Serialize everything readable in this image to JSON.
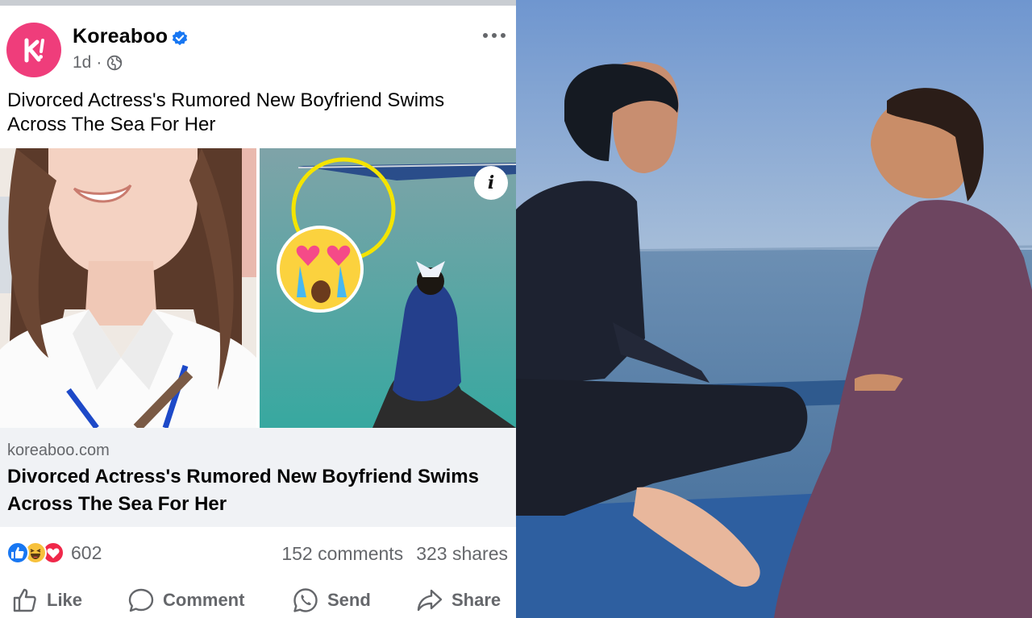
{
  "post": {
    "page_name": "Koreaboo",
    "time": "1d",
    "caption": "Divorced Actress's Rumored New Boyfriend Swims Across The Sea For Her",
    "info_label": "i",
    "link": {
      "domain": "koreaboo.com",
      "title": "Divorced Actress's Rumored New Boyfriend Swims Across The Sea For Her"
    },
    "reaction_count": "602",
    "comments": "152 comments",
    "shares": "323 shares",
    "actions": {
      "like": "Like",
      "comment": "Comment",
      "send": "Send",
      "share": "Share"
    }
  },
  "colors": {
    "brand_pink": "#ef3d7b",
    "verified_blue": "#1877f2",
    "muted_text": "#65676b",
    "link_bg": "#f0f2f5"
  },
  "icons": [
    "koreaboo-logo",
    "verified-icon",
    "globe-icon",
    "more-icon",
    "info-icon",
    "like-reaction-icon",
    "haha-reaction-icon",
    "love-reaction-icon",
    "like-icon",
    "comment-icon",
    "send-icon",
    "share-icon",
    "heart-eyes-emoji"
  ]
}
